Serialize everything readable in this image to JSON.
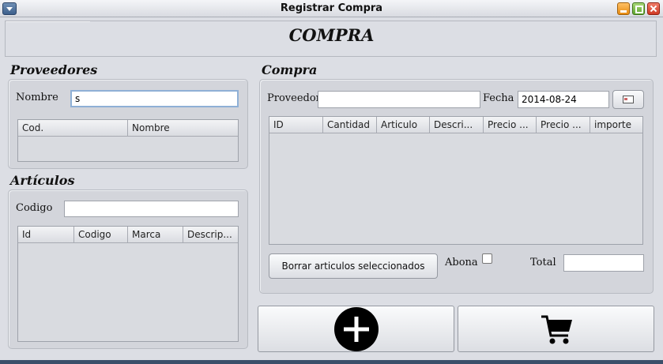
{
  "window": {
    "title": "Registrar Compra"
  },
  "header": {
    "title": "COMPRA"
  },
  "proveedores": {
    "title": "Proveedores",
    "nombre_label": "Nombre",
    "nombre_value": "s",
    "columns": [
      "Cod.",
      "Nombre"
    ]
  },
  "articulos": {
    "title": "Artículos",
    "codigo_label": "Codigo",
    "codigo_value": "",
    "columns": [
      "Id",
      "Codigo",
      "Marca",
      "Descrip..."
    ]
  },
  "compra": {
    "title": "Compra",
    "proveedor_label": "Proveedor",
    "proveedor_value": "",
    "fecha_label": "Fecha",
    "fecha_value": "2014-08-24",
    "columns": [
      "ID",
      "Cantidad",
      "Articulo",
      "Descri...",
      "Precio ...",
      "Precio ...",
      "importe"
    ],
    "borrar_label": "Borrar articulos seleccionados",
    "abona_label": "Abona",
    "abona_checked": false,
    "total_label": "Total",
    "total_value": ""
  },
  "actions": {
    "add_icon": "plus-circle-icon",
    "cart_icon": "shopping-cart-icon"
  }
}
